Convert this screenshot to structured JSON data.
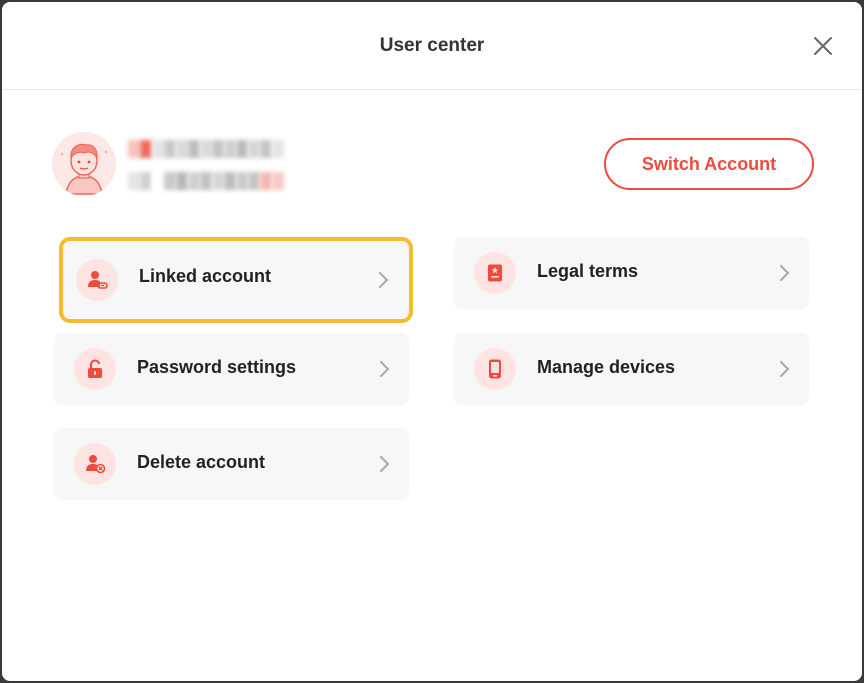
{
  "dialog": {
    "title": "User center",
    "close_icon": "close-icon"
  },
  "profile": {
    "avatar_icon": "avatar-icon",
    "switch_label": "Switch Account"
  },
  "menu": {
    "linked_account": {
      "label": "Linked account",
      "icon": "linked-account-icon"
    },
    "legal_terms": {
      "label": "Legal terms",
      "icon": "legal-terms-icon"
    },
    "password_settings": {
      "label": "Password settings",
      "icon": "padlock-icon"
    },
    "manage_devices": {
      "label": "Manage devices",
      "icon": "phone-icon"
    },
    "delete_account": {
      "label": "Delete account",
      "icon": "delete-user-icon"
    }
  },
  "colors": {
    "accent": "#ee4b3e",
    "selection": "#f7bb2f",
    "card_bg": "#f7f7f7",
    "icon_bg": "#fde4e2"
  }
}
